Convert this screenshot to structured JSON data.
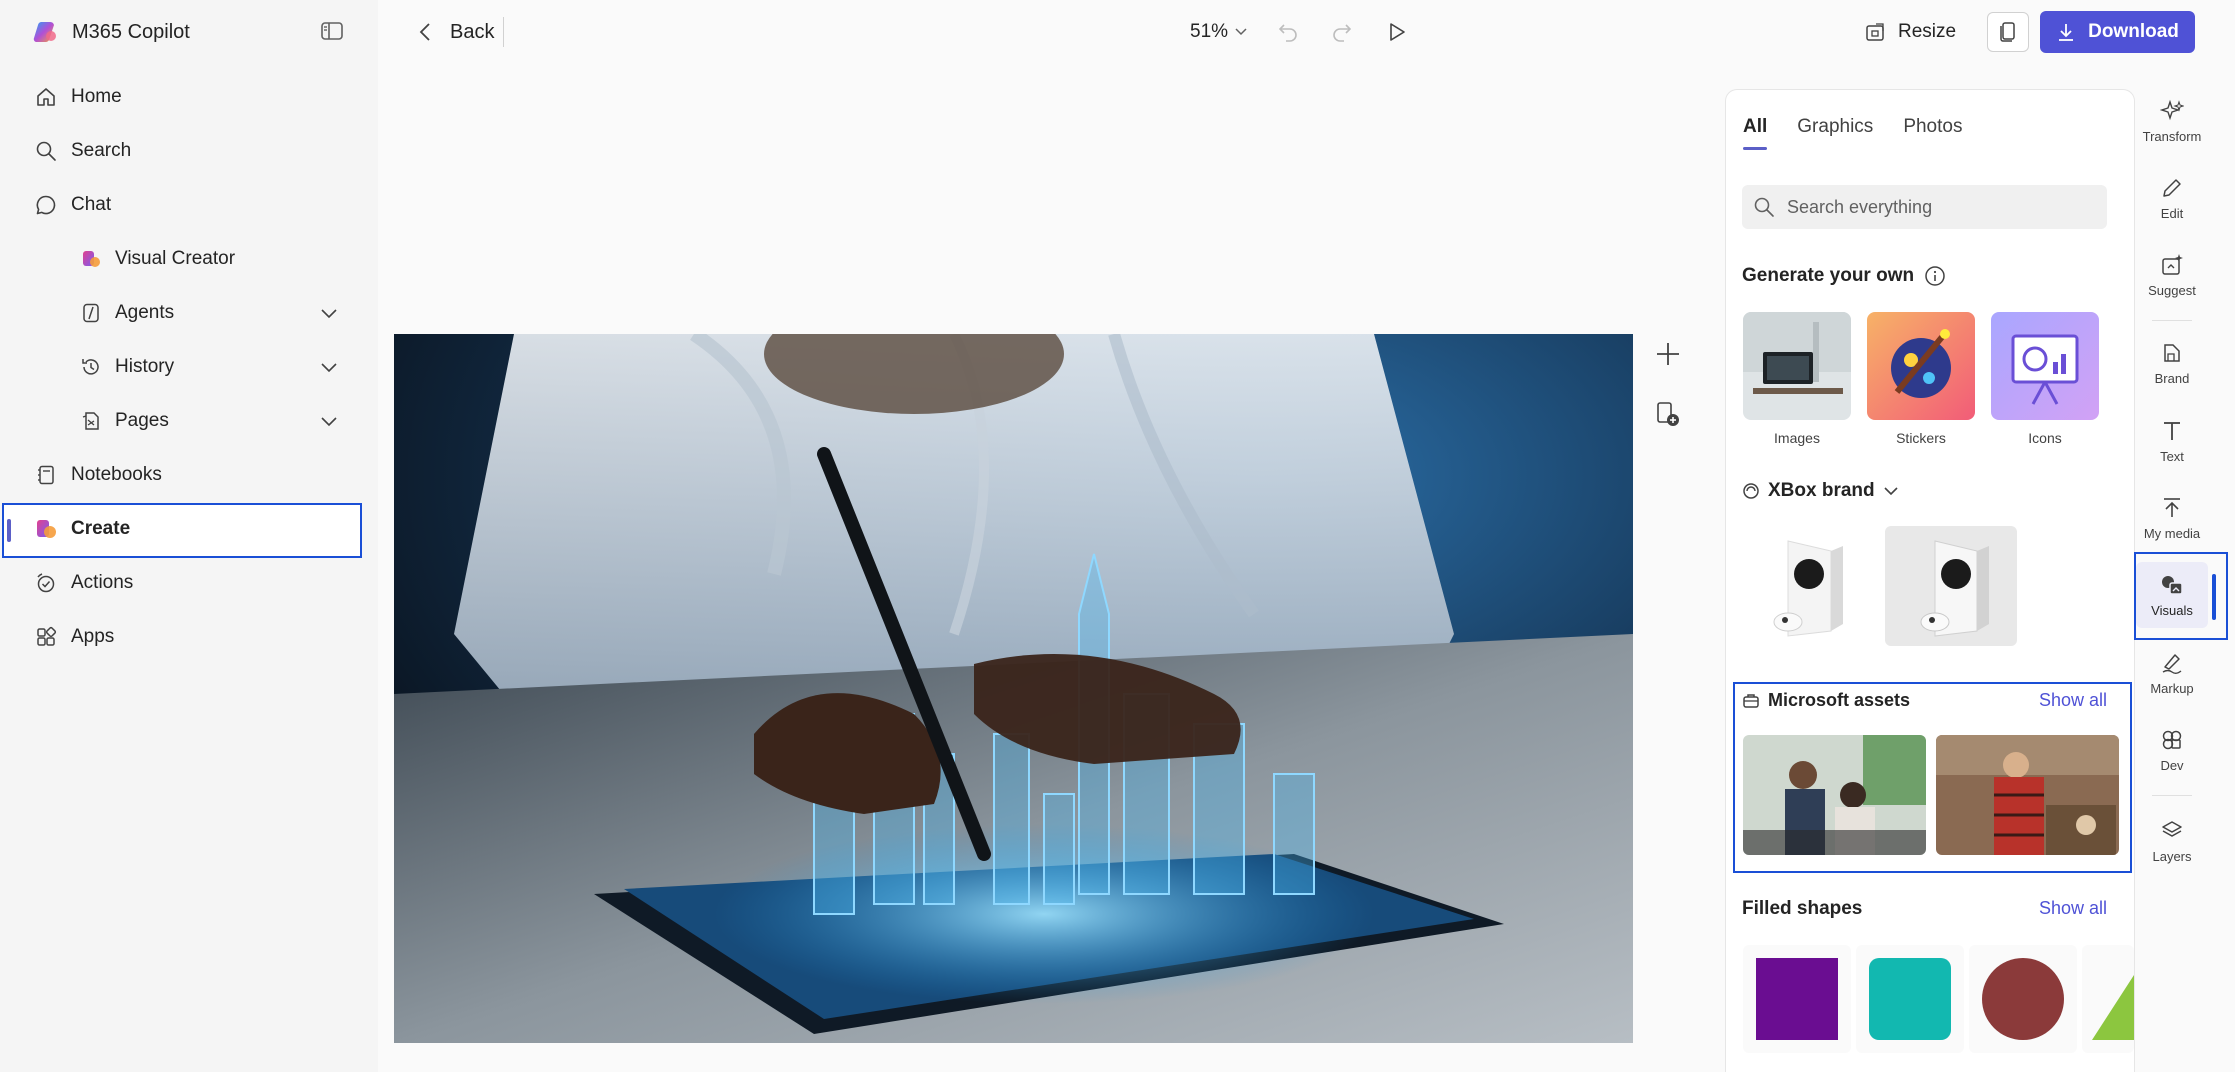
{
  "app": {
    "title": "M365 Copilot"
  },
  "sidebar": {
    "items": [
      {
        "label": "Home",
        "icon": "home-icon"
      },
      {
        "label": "Search",
        "icon": "search-icon"
      },
      {
        "label": "Chat",
        "icon": "chat-icon"
      },
      {
        "label": "Visual Creator",
        "icon": "visual-creator-icon"
      },
      {
        "label": "Agents",
        "icon": "agents-icon"
      },
      {
        "label": "History",
        "icon": "history-icon"
      },
      {
        "label": "Pages",
        "icon": "pages-icon"
      },
      {
        "label": "Notebooks",
        "icon": "notebook-icon"
      },
      {
        "label": "Create",
        "icon": "create-icon",
        "active": true
      },
      {
        "label": "Actions",
        "icon": "actions-icon"
      },
      {
        "label": "Apps",
        "icon": "apps-icon"
      }
    ]
  },
  "toolbar": {
    "back_label": "Back",
    "zoom_label": "51%",
    "resize_label": "Resize",
    "download_label": "Download"
  },
  "panel": {
    "tabs": [
      {
        "label": "All",
        "active": true
      },
      {
        "label": "Graphics"
      },
      {
        "label": "Photos"
      }
    ],
    "search": {
      "placeholder": "Search everything"
    },
    "generate": {
      "title": "Generate your own",
      "tiles": [
        {
          "label": "Images"
        },
        {
          "label": "Stickers"
        },
        {
          "label": "Icons"
        }
      ]
    },
    "brand_kit": {
      "title": "XBox brand"
    },
    "microsoft_assets": {
      "title": "Microsoft assets",
      "show_all": "Show all"
    },
    "filled_shapes": {
      "title": "Filled shapes",
      "show_all": "Show all",
      "colors": [
        "#6a0d91",
        "#12b8b0",
        "#8b3a3a",
        "#8cc63f"
      ]
    }
  },
  "rail": {
    "items": [
      {
        "label": "Transform"
      },
      {
        "label": "Edit"
      },
      {
        "label": "Suggest"
      },
      {
        "label": "Brand"
      },
      {
        "label": "Text"
      },
      {
        "label": "My media"
      },
      {
        "label": "Visuals",
        "active": true
      },
      {
        "label": "Markup"
      },
      {
        "label": "Dev"
      },
      {
        "label": "Layers"
      }
    ]
  },
  "colors": {
    "accent": "#4f52d6",
    "highlight_border": "#1a4fd6",
    "active_tab_underline": "#5b5fc7"
  }
}
